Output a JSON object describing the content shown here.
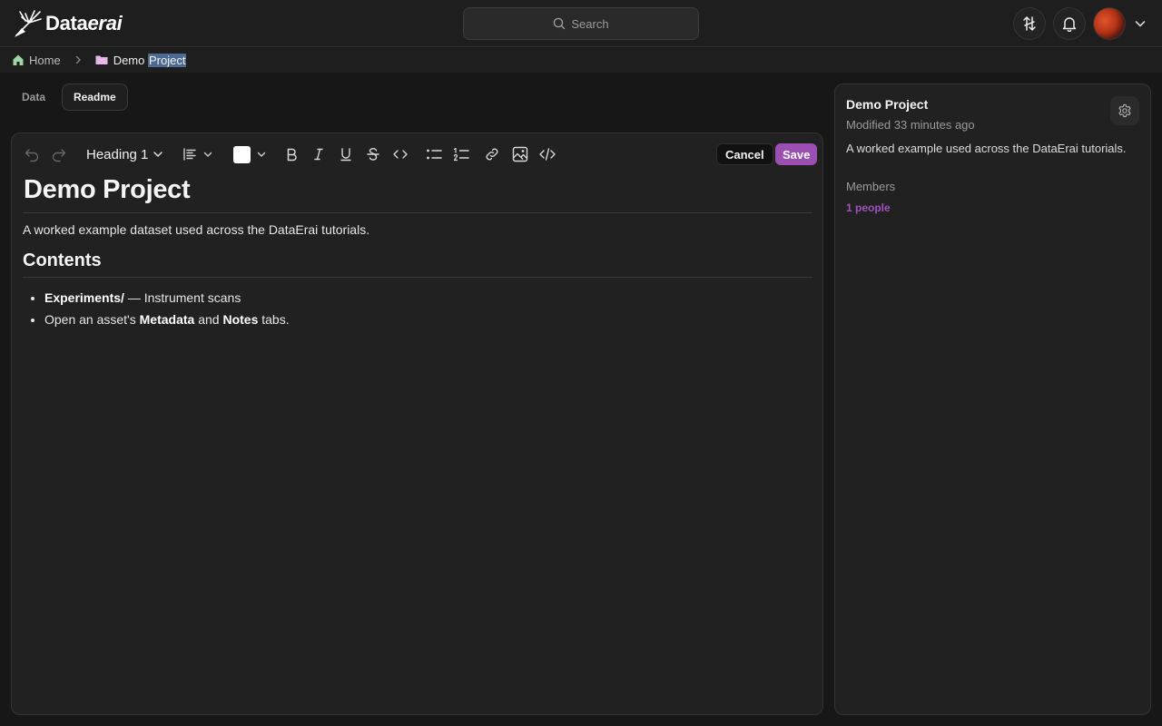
{
  "app": {
    "logo_plain": "Data",
    "logo_italic": "erai"
  },
  "search": {
    "placeholder": "Search"
  },
  "breadcrumb": {
    "home": "Home",
    "current_a": "Demo ",
    "current_b": "Project"
  },
  "tabs": [
    {
      "label": "Data",
      "active": false
    },
    {
      "label": "Readme",
      "active": true
    }
  ],
  "toolbar": {
    "heading_value": "Heading 1",
    "text_color": "#ffffff",
    "cancel_label": "Cancel",
    "save_label": "Save",
    "icons": [
      "undo-icon",
      "redo-icon",
      "align-icon",
      "bold-icon",
      "italic-icon",
      "underline-icon",
      "strikethrough-icon",
      "code-icon",
      "bullet-list-icon",
      "numbered-list-icon",
      "link-icon",
      "image-icon",
      "code-block-icon"
    ]
  },
  "document": {
    "title": "Demo Project",
    "intro": "A worked example dataset used across the DataErai tutorials.",
    "section_heading": "Contents",
    "items": [
      {
        "bold": "Experiments/",
        "rest": " — Instrument scans"
      },
      {
        "pre": "Open an asset's ",
        "bold1": "Metadata",
        "mid": " and ",
        "bold2": "Notes",
        "post": " tabs."
      }
    ]
  },
  "panel": {
    "title": "Demo Project",
    "modified": "Modified 33 minutes ago",
    "description": "A worked example used across the DataErai tutorials.",
    "members_label": "Members",
    "members_value": "1 people"
  },
  "colors": {
    "accent": "#9b4fb3",
    "accent_text": "#a152bd",
    "background": "#171717",
    "card": "#212121"
  }
}
